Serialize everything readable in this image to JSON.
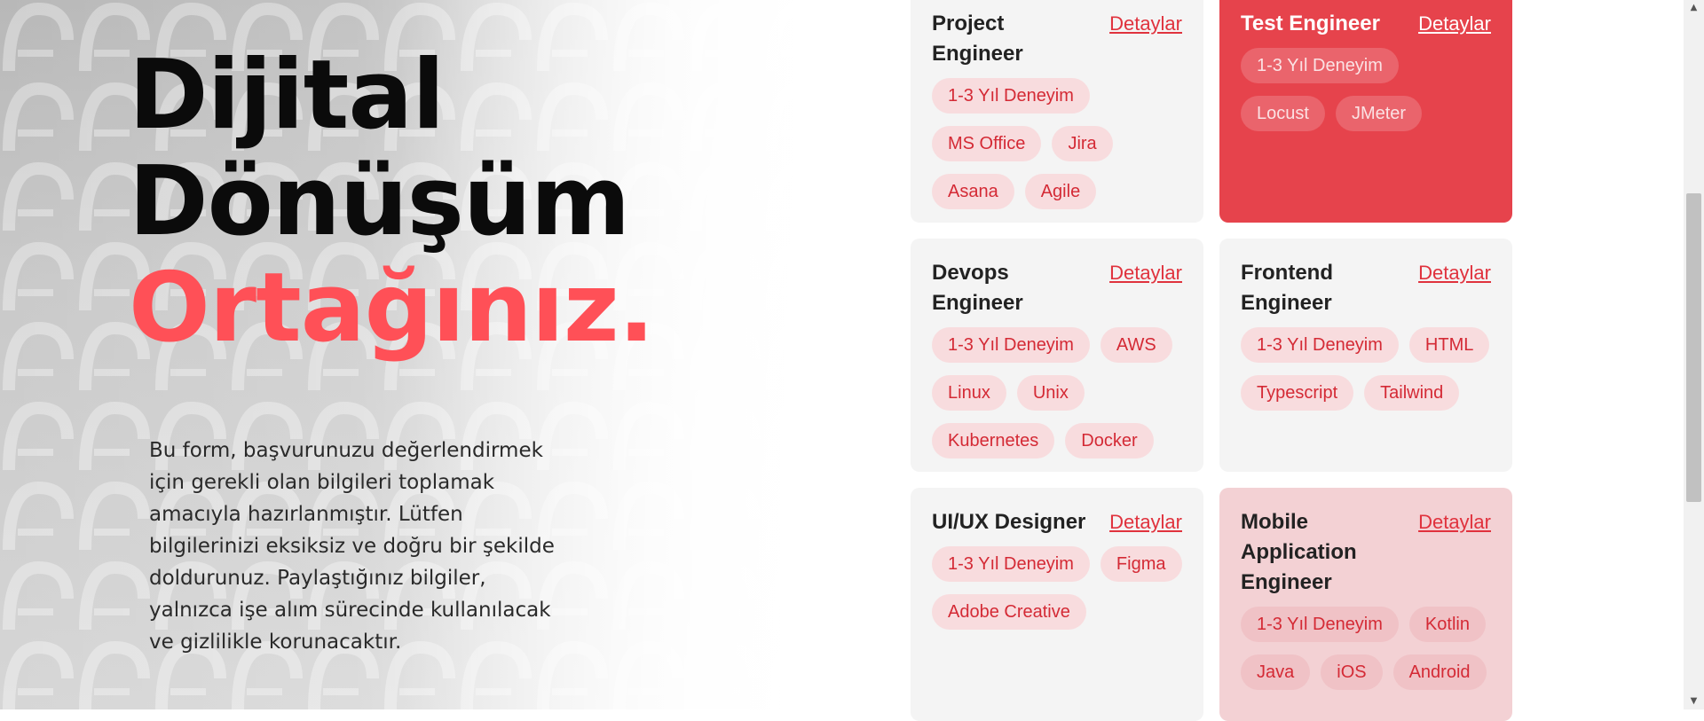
{
  "hero": {
    "title_line1": "Dijital",
    "title_line2": "Dönüşüm",
    "title_line3": "Ortağınız.",
    "intro": "Bu form, başvurunuzu değerlendirmek için gerekli olan bilgileri toplamak amacıyla hazırlanmıştır. Lütfen bilgilerinizi eksiksiz ve doğru bir şekilde doldurunuz. Paylaştığınız bilgiler, yalnızca işe alım sürecinde kullanılacak ve gizlilikle korunacaktır."
  },
  "colors": {
    "accent": "#ff5057",
    "card_red": "#e6434c",
    "card_pink": "#f3d1d4",
    "card_gray": "#f4f4f4"
  },
  "cards": [
    {
      "title": "Project Engineer",
      "link": "Detaylar",
      "tags": [
        "1-3 Yıl Deneyim",
        "MS Office",
        "Jira",
        "Asana",
        "Agile"
      ]
    },
    {
      "title": "Test Engineer",
      "link": "Detaylar",
      "tags": [
        "1-3 Yıl Deneyim",
        "Locust",
        "JMeter"
      ]
    },
    {
      "title": "Devops Engineer",
      "link": "Detaylar",
      "tags": [
        "1-3 Yıl Deneyim",
        "AWS",
        "Linux",
        "Unix",
        "Kubernetes",
        "Docker"
      ]
    },
    {
      "title": "Frontend Engineer",
      "link": "Detaylar",
      "tags": [
        "1-3 Yıl Deneyim",
        "HTML",
        "Typescript",
        "Tailwind"
      ]
    },
    {
      "title": "UI/UX Designer",
      "link": "Detaylar",
      "tags": [
        "1-3 Yıl Deneyim",
        "Figma",
        "Adobe Creative"
      ]
    },
    {
      "title": "Mobile Application Engineer",
      "link": "Detaylar",
      "tags": [
        "1-3 Yıl Deneyim",
        "Kotlin",
        "Java",
        "iOS",
        "Android"
      ]
    }
  ]
}
